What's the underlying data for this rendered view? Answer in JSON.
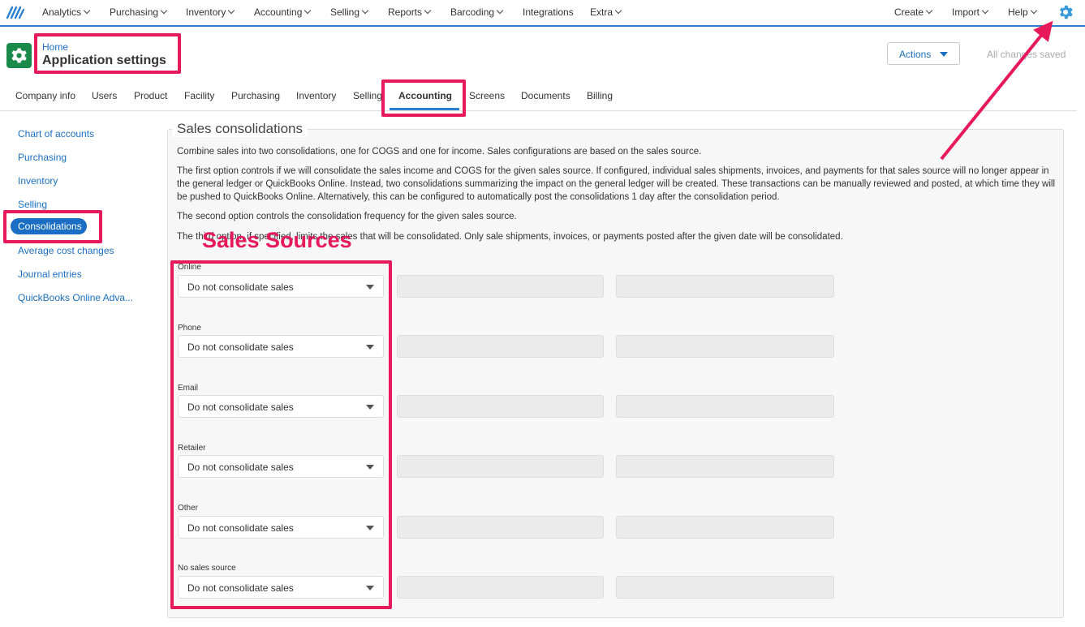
{
  "topnav": {
    "left_items": [
      {
        "label": "Analytics",
        "has_menu": true
      },
      {
        "label": "Purchasing",
        "has_menu": true
      },
      {
        "label": "Inventory",
        "has_menu": true
      },
      {
        "label": "Accounting",
        "has_menu": true
      },
      {
        "label": "Selling",
        "has_menu": true
      },
      {
        "label": "Reports",
        "has_menu": true
      },
      {
        "label": "Barcoding",
        "has_menu": true
      },
      {
        "label": "Integrations",
        "has_menu": false
      },
      {
        "label": "Extra",
        "has_menu": true
      }
    ],
    "right_items": [
      {
        "label": "Create",
        "has_menu": true
      },
      {
        "label": "Import",
        "has_menu": true
      },
      {
        "label": "Help",
        "has_menu": true
      }
    ],
    "settings_icon": "gear-icon"
  },
  "header": {
    "breadcrumb_home": "Home",
    "title": "Application settings",
    "actions_label": "Actions",
    "save_status": "All changes saved"
  },
  "tabs": [
    {
      "label": "Company info"
    },
    {
      "label": "Users"
    },
    {
      "label": "Product"
    },
    {
      "label": "Facility"
    },
    {
      "label": "Purchasing"
    },
    {
      "label": "Inventory"
    },
    {
      "label": "Selling"
    },
    {
      "label": "Accounting",
      "active": true
    },
    {
      "label": "Screens"
    },
    {
      "label": "Documents"
    },
    {
      "label": "Billing"
    }
  ],
  "sidebar": {
    "items": [
      {
        "label": "Chart of accounts"
      },
      {
        "label": "Purchasing"
      },
      {
        "label": "Inventory"
      },
      {
        "label": "Selling"
      },
      {
        "label": "Consolidations",
        "active": true
      },
      {
        "label": "Average cost changes"
      },
      {
        "label": "Journal entries"
      },
      {
        "label": "QuickBooks Online Adva..."
      }
    ]
  },
  "section": {
    "title": "Sales consolidations",
    "paragraphs": [
      "Combine sales into two consolidations, one for COGS and one for income. Sales configurations are based on the sales source.",
      "The first option controls if we will consolidate the sales income and COGS for the given sales source. If configured, individual sales shipments, invoices, and payments for that sales source will no longer appear in the general ledger or QuickBooks Online. Instead, two consolidations summarizing the impact on the general ledger will be created. These transactions can be manually reviewed and posted, at which time they will be pushed to QuickBooks Online. Alternatively, this can be configured to automatically post the consolidations 1 day after the consolidation period.",
      "The second option controls the consolidation frequency for the given sales source.",
      "The third option, if specified, limits the sales that will be consolidated. Only sale shipments, invoices, or payments posted after the given date will be consolidated."
    ],
    "sources": [
      {
        "label": "Online",
        "value": "Do not consolidate sales"
      },
      {
        "label": "Phone",
        "value": "Do not consolidate sales"
      },
      {
        "label": "Email",
        "value": "Do not consolidate sales"
      },
      {
        "label": "Retailer",
        "value": "Do not consolidate sales"
      },
      {
        "label": "Other",
        "value": "Do not consolidate sales"
      },
      {
        "label": "No sales source",
        "value": "Do not consolidate sales"
      }
    ]
  },
  "annotation": {
    "label": "Sales Sources",
    "color": "#e8195a"
  },
  "colors": {
    "accent": "#1a6fc4",
    "brand_green": "#1a8a4a",
    "highlight": "#e8195a"
  }
}
